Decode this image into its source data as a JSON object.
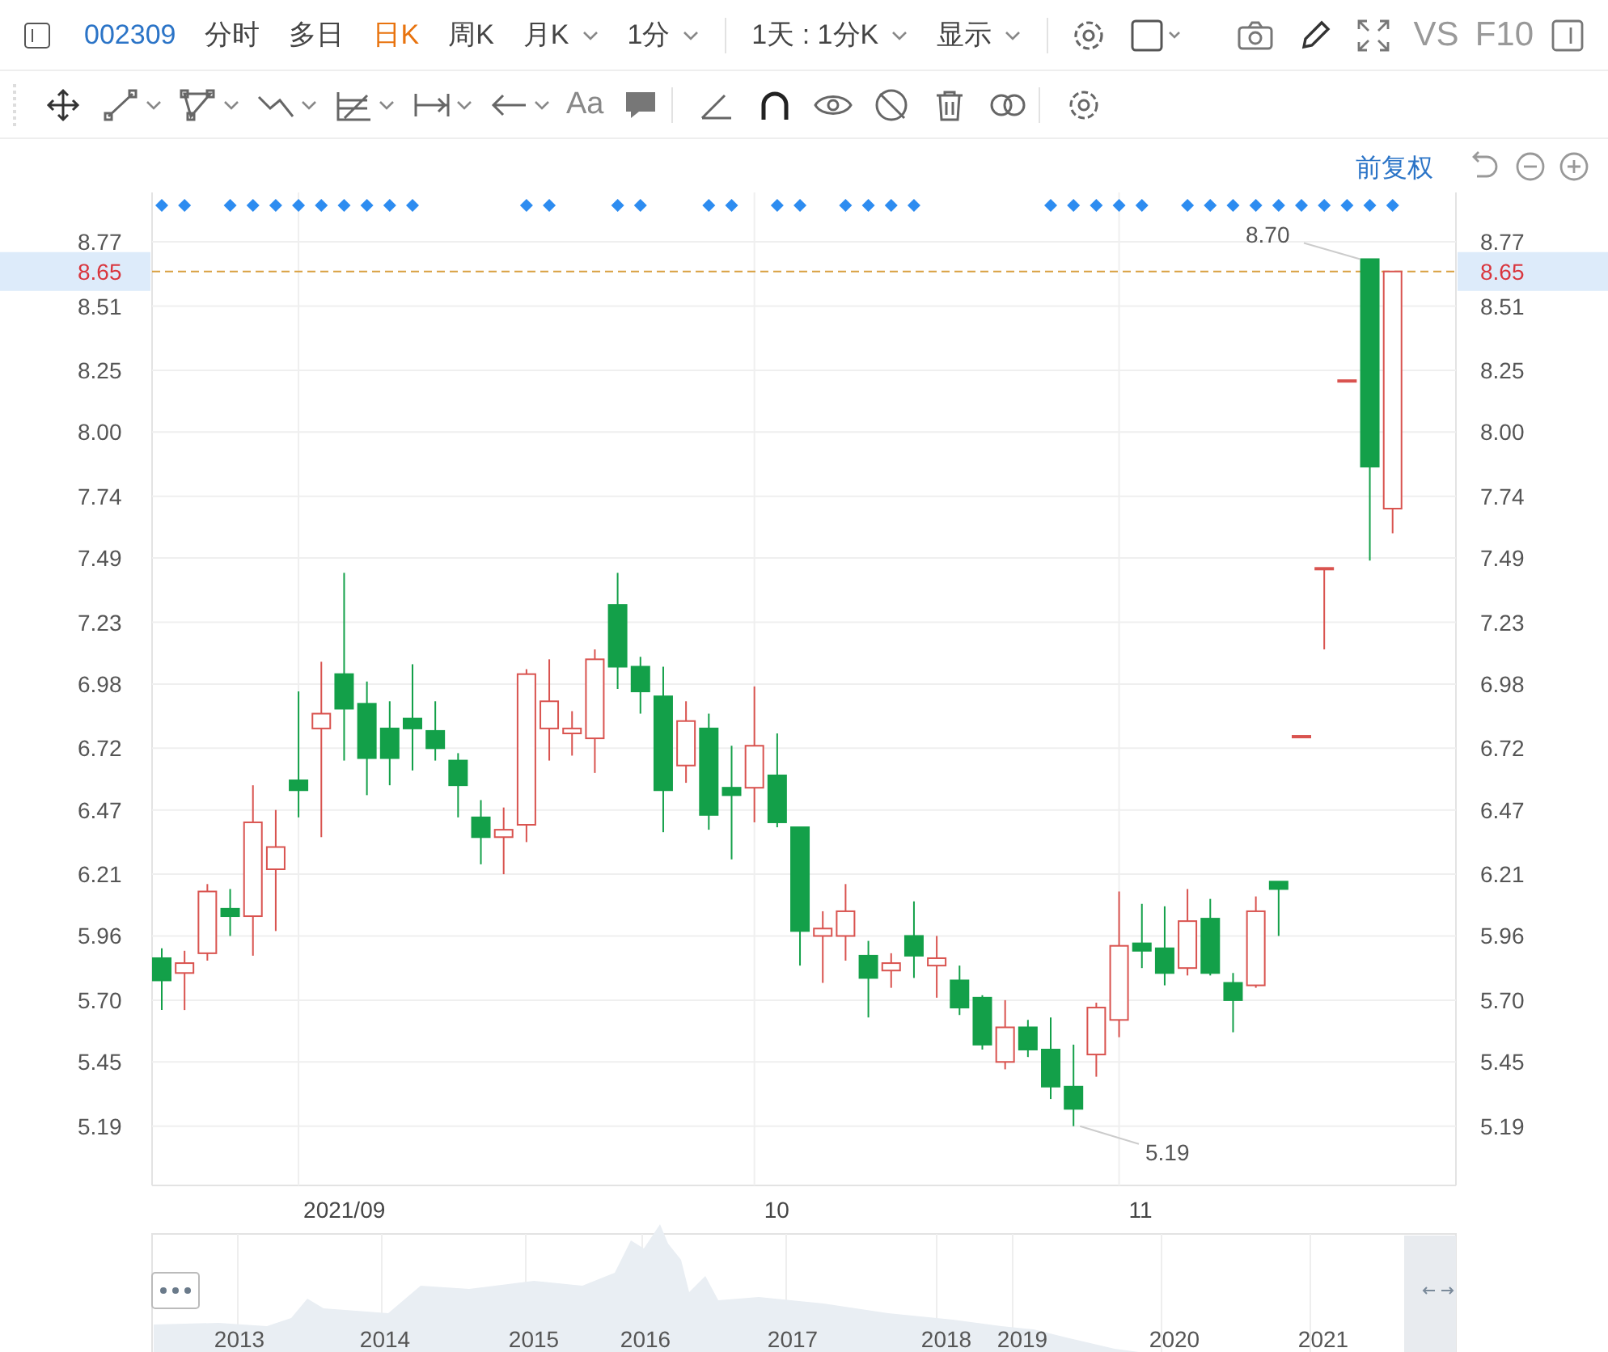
{
  "toolbar": {
    "symbol": "002309",
    "periods": [
      {
        "label": "分时",
        "selected": false,
        "dropdown": false
      },
      {
        "label": "多日",
        "selected": false,
        "dropdown": false
      },
      {
        "label": "日K",
        "selected": true,
        "dropdown": false
      },
      {
        "label": "周K",
        "selected": false,
        "dropdown": false
      },
      {
        "label": "月K",
        "selected": false,
        "dropdown": true
      },
      {
        "label": "1分",
        "selected": false,
        "dropdown": true
      }
    ],
    "interval": "1天 : 1分K",
    "display": "显示",
    "compare": "VS",
    "f10": "F10",
    "text_tool": "Aa"
  },
  "chart": {
    "adjust": "前复权",
    "event_marks": [
      true,
      true,
      false,
      true,
      true,
      true,
      true,
      true,
      true,
      true,
      true,
      true,
      false,
      false,
      false,
      false,
      true,
      true,
      false,
      false,
      true,
      true,
      false,
      false,
      true,
      true,
      false,
      true,
      true,
      false,
      true,
      true,
      true,
      true,
      false,
      false,
      false,
      false,
      false,
      true,
      true,
      true,
      true,
      true,
      false,
      true,
      true,
      true,
      true,
      true,
      true,
      true,
      true,
      true,
      true
    ],
    "date_labels": [
      "2021/09",
      "10",
      "11"
    ],
    "right_price_label": "8.65",
    "chart_data": {
      "type": "candlestick",
      "categories": [
        null,
        null,
        null,
        null,
        null,
        null,
        null,
        null,
        null,
        null,
        null,
        null,
        null,
        null,
        null,
        null,
        null,
        null,
        null,
        null,
        null,
        null,
        null,
        null,
        null,
        null,
        null,
        null,
        null,
        null,
        null,
        null,
        null,
        null,
        null,
        null,
        null,
        null,
        null,
        null,
        null,
        null,
        null,
        null,
        null,
        null,
        null,
        null,
        null,
        null,
        null,
        null,
        null,
        null,
        null
      ],
      "ohlc": [
        [
          5.87,
          5.91,
          5.66,
          5.78
        ],
        [
          5.81,
          5.9,
          5.66,
          5.85
        ],
        [
          5.89,
          6.17,
          5.86,
          6.14
        ],
        [
          6.07,
          6.15,
          5.96,
          6.04
        ],
        [
          6.04,
          6.57,
          5.88,
          6.42
        ],
        [
          6.23,
          6.47,
          5.98,
          6.32
        ],
        [
          6.59,
          6.95,
          6.44,
          6.55
        ],
        [
          6.8,
          7.07,
          6.36,
          6.86
        ],
        [
          7.02,
          7.43,
          6.67,
          6.88
        ],
        [
          6.9,
          6.99,
          6.53,
          6.68
        ],
        [
          6.8,
          6.91,
          6.57,
          6.68
        ],
        [
          6.84,
          7.06,
          6.63,
          6.8
        ],
        [
          6.79,
          6.91,
          6.67,
          6.72
        ],
        [
          6.67,
          6.7,
          6.44,
          6.57
        ],
        [
          6.44,
          6.51,
          6.25,
          6.36
        ],
        [
          6.36,
          6.48,
          6.21,
          6.39
        ],
        [
          6.41,
          7.04,
          6.34,
          7.02
        ],
        [
          6.8,
          7.08,
          6.67,
          6.91
        ],
        [
          6.78,
          6.87,
          6.69,
          6.8
        ],
        [
          6.76,
          7.12,
          6.62,
          7.08
        ],
        [
          7.3,
          7.43,
          6.96,
          7.05
        ],
        [
          7.05,
          7.09,
          6.86,
          6.95
        ],
        [
          6.93,
          7.05,
          6.38,
          6.55
        ],
        [
          6.65,
          6.91,
          6.58,
          6.83
        ],
        [
          6.8,
          6.86,
          6.39,
          6.45
        ],
        [
          6.56,
          6.73,
          6.27,
          6.53
        ],
        [
          6.56,
          6.97,
          6.42,
          6.73
        ],
        [
          6.61,
          6.78,
          6.4,
          6.42
        ],
        [
          6.4,
          6.4,
          5.84,
          5.98
        ],
        [
          5.96,
          6.06,
          5.77,
          5.99
        ],
        [
          5.96,
          6.17,
          5.86,
          6.06
        ],
        [
          5.88,
          5.94,
          5.63,
          5.79
        ],
        [
          5.82,
          5.89,
          5.75,
          5.85
        ],
        [
          5.96,
          6.1,
          5.79,
          5.88
        ],
        [
          5.84,
          5.96,
          5.71,
          5.87
        ],
        [
          5.78,
          5.84,
          5.64,
          5.67
        ],
        [
          5.71,
          5.72,
          5.5,
          5.52
        ],
        [
          5.45,
          5.7,
          5.42,
          5.59
        ],
        [
          5.59,
          5.62,
          5.47,
          5.5
        ],
        [
          5.5,
          5.63,
          5.3,
          5.35
        ],
        [
          5.35,
          5.52,
          5.19,
          5.26
        ],
        [
          5.48,
          5.69,
          5.39,
          5.67
        ],
        [
          5.62,
          6.14,
          5.55,
          5.92
        ],
        [
          5.93,
          6.09,
          5.83,
          5.9
        ],
        [
          5.91,
          6.08,
          5.76,
          5.81
        ],
        [
          5.83,
          6.15,
          5.8,
          6.02
        ],
        [
          6.03,
          6.11,
          5.8,
          5.81
        ],
        [
          5.77,
          5.81,
          5.57,
          5.7
        ],
        [
          5.76,
          6.12,
          5.75,
          6.06
        ],
        [
          6.18,
          6.18,
          5.96,
          6.15
        ],
        [
          6.77,
          6.77,
          6.77,
          6.77
        ],
        [
          7.45,
          7.45,
          7.12,
          7.45
        ],
        [
          8.21,
          8.21,
          8.21,
          8.21
        ],
        [
          8.7,
          8.7,
          7.48,
          7.86
        ],
        [
          7.69,
          8.65,
          7.59,
          8.65
        ]
      ],
      "ylim": [
        4.95,
        8.97
      ],
      "grid": true,
      "yticks": [
        {
          "value": 8.77,
          "label": "8.77"
        },
        {
          "value": 8.51,
          "label": "8.51"
        },
        {
          "value": 8.25,
          "label": "8.25"
        },
        {
          "value": 8.0,
          "label": "8.00"
        },
        {
          "value": 7.74,
          "label": "7.74"
        },
        {
          "value": 7.49,
          "label": "7.49"
        },
        {
          "value": 7.23,
          "label": "7.23"
        },
        {
          "value": 6.98,
          "label": "6.98"
        },
        {
          "value": 6.72,
          "label": "6.72"
        },
        {
          "value": 6.47,
          "label": "6.47"
        },
        {
          "value": 6.21,
          "label": "6.21"
        },
        {
          "value": 5.96,
          "label": "5.96"
        },
        {
          "value": 5.7,
          "label": "5.70"
        },
        {
          "value": 5.45,
          "label": "5.45"
        },
        {
          "value": 5.19,
          "label": "5.19"
        }
      ],
      "ref_lines": [
        {
          "axis": "y",
          "value": 8.65,
          "label": "8.65"
        }
      ]
    },
    "extreme_labels": [
      "8.70",
      "5.19"
    ]
  },
  "navigator": {
    "years": [
      "2013",
      "2014",
      "2015",
      "2016",
      "2017",
      "2018",
      "2019",
      "2020",
      "2021"
    ]
  }
}
